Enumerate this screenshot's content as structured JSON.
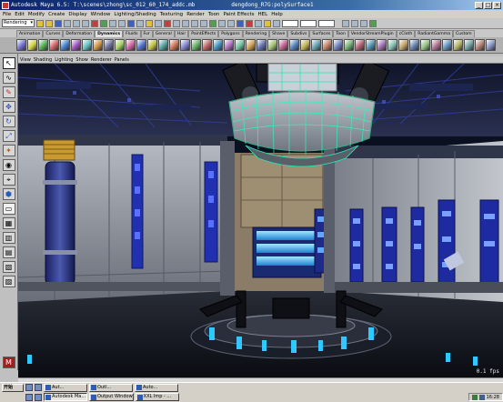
{
  "window": {
    "title": "Autodesk Maya 6.5: T:\\scenes\\zhong\\sc_012_60_174_addc.mb",
    "title_object": "dengdong_R7G:polySurface1",
    "controls": [
      "_",
      "□",
      "×"
    ]
  },
  "menu": [
    "File",
    "Edit",
    "Modify",
    "Create",
    "Display",
    "Window",
    "Lighting/Shading",
    "Texturing",
    "Render",
    "Toon",
    "Paint Effects",
    "HEL",
    "Help"
  ],
  "statusline": {
    "mode": "Rendering"
  },
  "shelf": {
    "tabs": [
      "Animation",
      "Curves",
      "Deformation",
      "Dynamics",
      "Fluids",
      "Fur",
      "General",
      "Hair",
      "PaintEffects",
      "Polygons",
      "Rendering",
      "Shave",
      "Subdivs",
      "Surfaces",
      "Toon",
      "VendorStreamPlugin",
      "cCloth",
      "RadiantGamma",
      "Custom"
    ],
    "active_tab": "Dynamics",
    "icon_colors": [
      "#6f6fd0",
      "#d0d040",
      "#50b050",
      "#d06060",
      "#4080d0",
      "#a050c0",
      "#60c0c0",
      "#d09040",
      "#7070a0",
      "#a0d060",
      "#d060a0",
      "#5070d0",
      "#c0c040",
      "#50a0a0",
      "#d07050",
      "#8080d0",
      "#60b060",
      "#c06060",
      "#4090c0",
      "#b070c0",
      "#70c0a0",
      "#d0a050",
      "#6070b0",
      "#a0c070",
      "#c06090",
      "#5080c0",
      "#c0b050",
      "#60a0b0",
      "#c08060",
      "#7080c0",
      "#70b070",
      "#b06070",
      "#5090b0",
      "#a070b0",
      "#80c0b0",
      "#c0a060",
      "#6080b0",
      "#90c080",
      "#b07090",
      "#6090c0",
      "#b0b060",
      "#70a0a0",
      "#b08070",
      "#8090c0"
    ]
  },
  "viewport": {
    "menu": [
      "View",
      "Shading",
      "Lighting",
      "Show",
      "Renderer",
      "Panels"
    ],
    "fps": "0.1 fps"
  },
  "taskbar": {
    "start": "开始",
    "buttons": [
      {
        "label": "Aut...",
        "active": false
      },
      {
        "label": "Outl...",
        "active": false
      },
      {
        "label": "Auto...",
        "active": false
      },
      {
        "label": "Autodesk Ma...",
        "active": true
      },
      {
        "label": "Output Window",
        "active": false
      },
      {
        "label": "XXL Imp - ...",
        "active": false
      }
    ],
    "clock": "16:28"
  }
}
